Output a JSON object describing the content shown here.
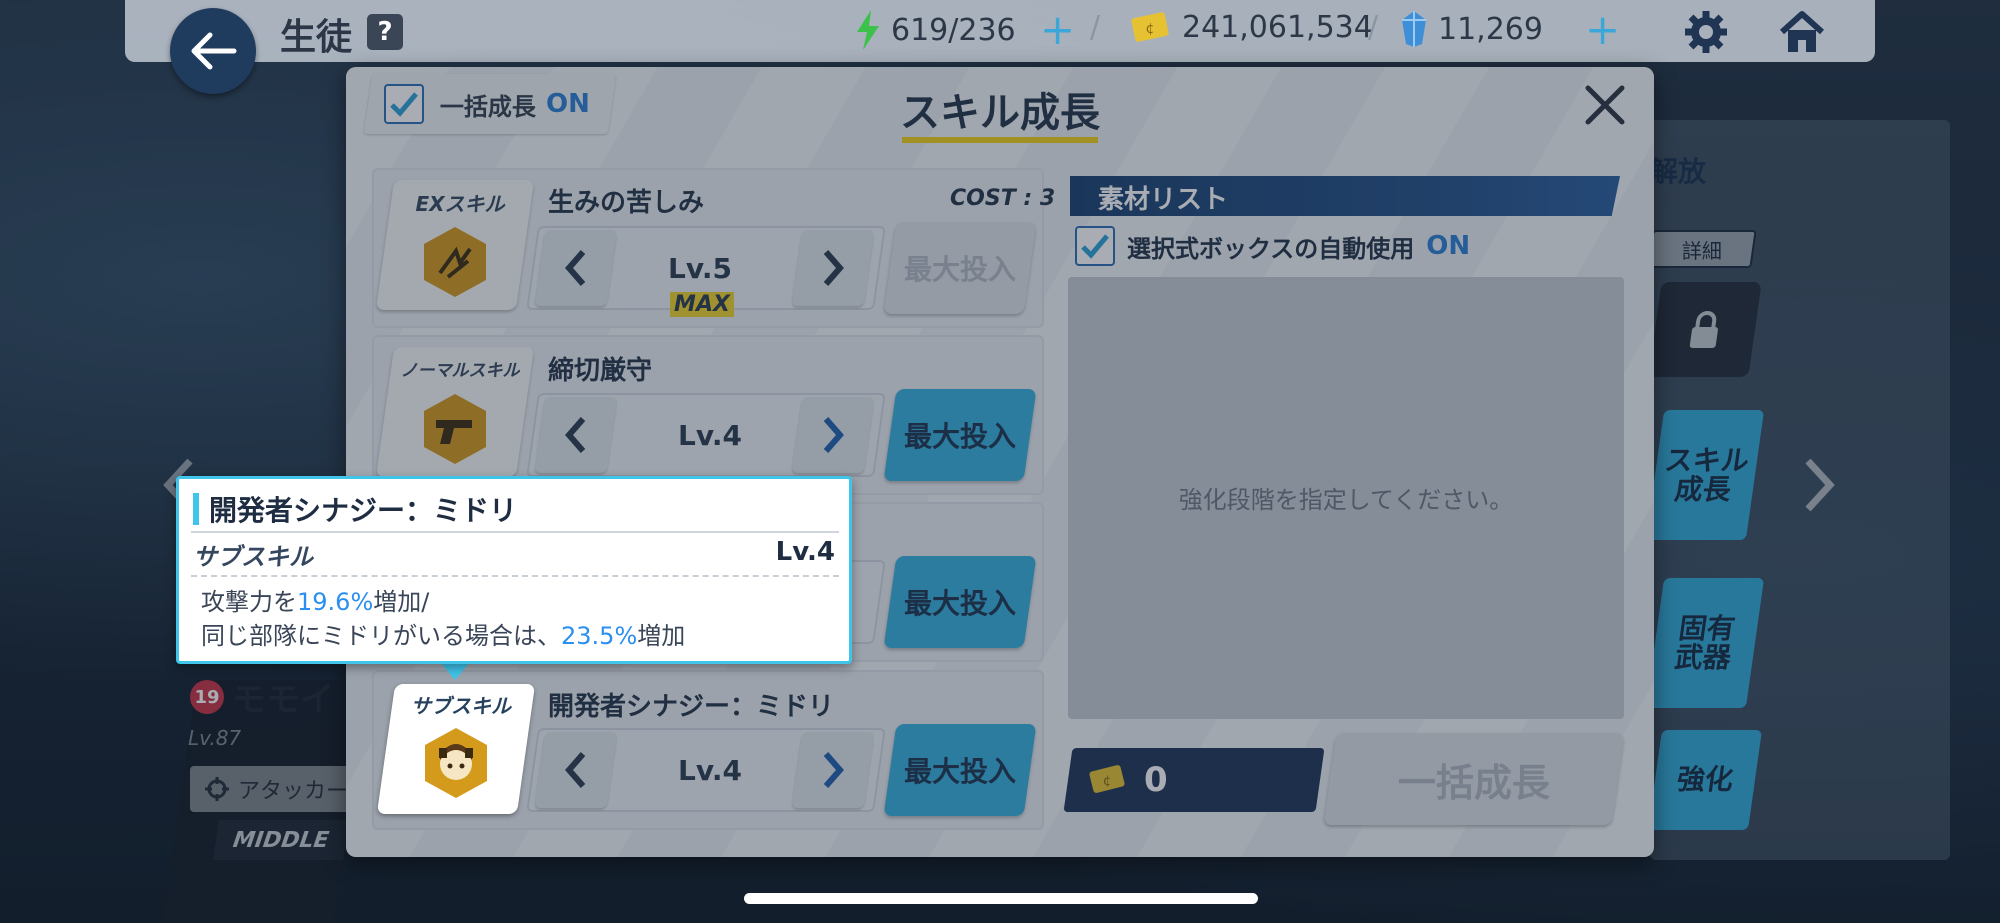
{
  "topbar": {
    "title": "生徒",
    "help": "?",
    "ap": "619/236",
    "credits": "241,061,534",
    "pyroxene": "11,269",
    "separator": "/"
  },
  "background": {
    "release_label": "解放",
    "detail_label": "詳細",
    "skill_growth_side": "スキル\n成長",
    "unique_weapon_side": "固有\n武器",
    "enhance_side": "強化",
    "student_level_badge": "19",
    "student_name": "モモイ",
    "student_lv": "Lv.87",
    "role": "アタッカー",
    "position": "MIDDLE"
  },
  "modal": {
    "title": "スキル成長",
    "bulk_label": "一括成長",
    "bulk_state": "ON",
    "material_list_label": "素材リスト",
    "auto_use_label": "選択式ボックスの自動使用",
    "auto_use_state": "ON",
    "placeholder": "強化段階を指定してください。",
    "credit_cost": "0",
    "bulk_growth_button": "一括成長"
  },
  "skills": [
    {
      "type": "EXスキル",
      "name": "生みの苦しみ",
      "cost": "COST : 3",
      "level": "Lv.5",
      "max_badge": "MAX",
      "max_button": "最大投入",
      "enabled": false
    },
    {
      "type": "ノーマルスキル",
      "name": "締切厳守",
      "level": "Lv.4",
      "max_button": "最大投入",
      "enabled": true
    },
    {
      "max_button": "最大投入",
      "enabled": true
    },
    {
      "type": "サブスキル",
      "name": "開発者シナジー：ミドリ",
      "level": "Lv.4",
      "max_button": "最大投入",
      "enabled": true
    }
  ],
  "tooltip": {
    "title": "開発者シナジー：ミドリ",
    "type": "サブスキル",
    "level": "Lv.4",
    "desc_1a": "攻撃力を",
    "desc_1b": "19.6%",
    "desc_1c": "増加/",
    "desc_2a": "同じ部隊にミドリがいる場合は、",
    "desc_2b": "23.5%",
    "desc_2c": "増加"
  },
  "colors": {
    "accent_blue": "#35b0df",
    "highlight_text": "#2b8ff0",
    "title_underline": "#f3d21b",
    "navy": "#1d3556",
    "skill_icon_gold": "#d49a1c"
  },
  "icons": {
    "back": "arrow-left-icon",
    "ap": "lightning-icon",
    "credit": "credit-card-icon",
    "pyroxene": "gem-icon",
    "settings": "gear-icon",
    "home": "home-icon",
    "close": "close-icon",
    "lock": "lock-icon"
  }
}
